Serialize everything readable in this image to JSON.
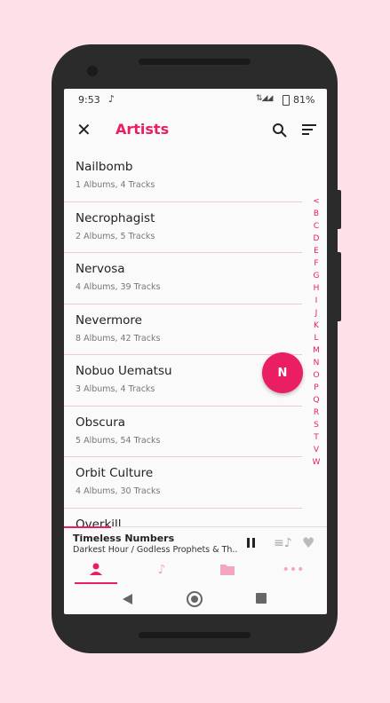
{
  "status": {
    "time": "9:53",
    "battery": "81%"
  },
  "header": {
    "title": "Artists"
  },
  "artists": [
    {
      "name": "Nailbomb",
      "meta": "1 Albums,  4 Tracks"
    },
    {
      "name": "Necrophagist",
      "meta": "2 Albums,  5 Tracks"
    },
    {
      "name": "Nervosa",
      "meta": "4 Albums, 39 Tracks"
    },
    {
      "name": "Nevermore",
      "meta": "8 Albums, 42 Tracks"
    },
    {
      "name": "Nobuo Uematsu",
      "meta": "3 Albums,  4 Tracks"
    },
    {
      "name": "Obscura",
      "meta": "5 Albums, 54 Tracks"
    },
    {
      "name": "Orbit Culture",
      "meta": "4 Albums, 30 Tracks"
    },
    {
      "name": "Overkill",
      "meta": ""
    }
  ],
  "alphabet": [
    "<",
    "B",
    "C",
    "D",
    "E",
    "F",
    "G",
    "H",
    "I",
    "J",
    "K",
    "L",
    "M",
    "N",
    "O",
    "P",
    "Q",
    "R",
    "S",
    "T",
    "V",
    "W"
  ],
  "fab": {
    "letter": "N"
  },
  "now_playing": {
    "title": "Timeless Numbers",
    "subtitle": "Darkest Hour / Godless Prophets & Th..",
    "progress": 0.18
  },
  "bottom_nav": [
    "artists",
    "songs",
    "folders",
    "more"
  ],
  "colors": {
    "accent": "#e91e63",
    "background": "#fde0e8"
  }
}
